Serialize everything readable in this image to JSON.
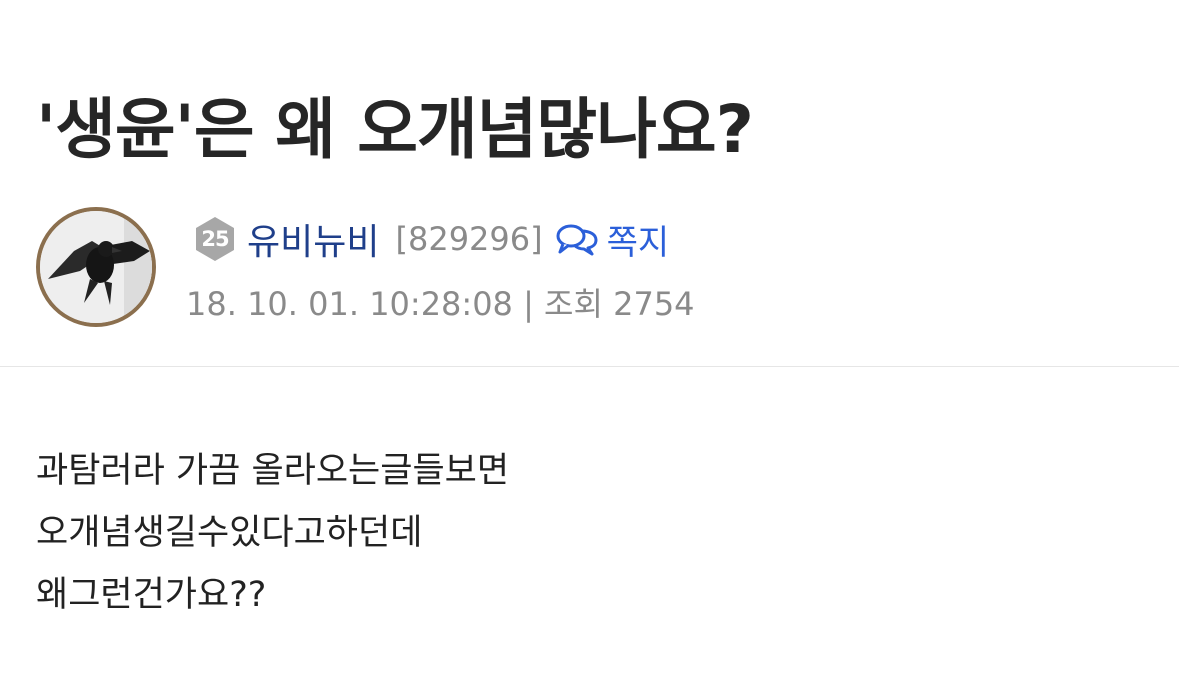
{
  "post": {
    "title": "'생윤'은 왜 오개념많나요?",
    "author": {
      "level": "25",
      "nickname": "유비뉴비",
      "user_id": "[829296]",
      "message_label": "쪽지",
      "level_badge_color": "#a7a7a7",
      "name_color": "#1f3f8a"
    },
    "datetime": "18. 10. 01. 10:28:08",
    "separator": "|",
    "views_label": "조회",
    "views": "2754",
    "body_lines": [
      "과탐러라 가끔 올라오는글들보면",
      "오개념생길수있다고하던데",
      "왜그런건가요??"
    ]
  },
  "icons": {
    "level": "hexagon-level-badge",
    "message": "chat-bubbles-icon"
  },
  "colors": {
    "accent": "#2b5fd9",
    "avatar_border": "#8b6f4e",
    "meta_text": "#8a8a8a"
  }
}
